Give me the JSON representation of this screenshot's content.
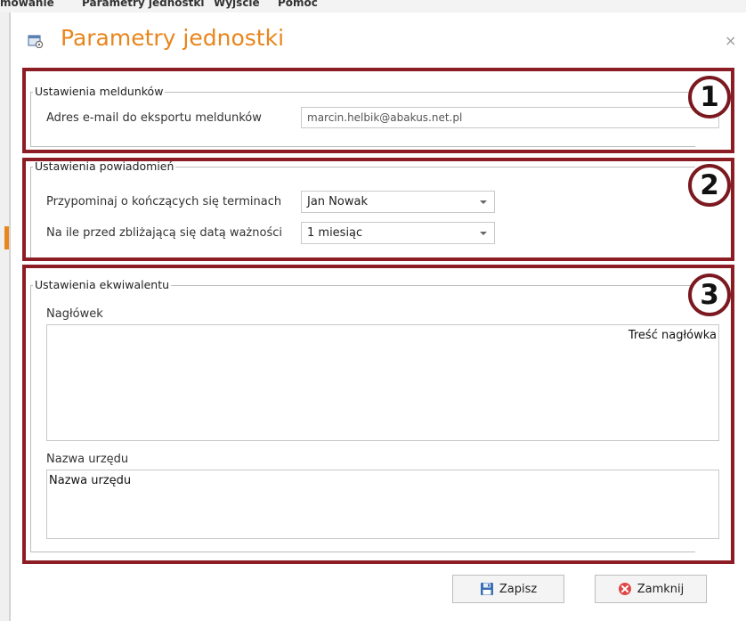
{
  "background_menu": {
    "items": [
      "mowanie",
      "Parametry jednostki",
      "Wyjście",
      "Pomoc"
    ]
  },
  "dialog": {
    "title": "Parametry jednostki",
    "title_color": "#e8861c",
    "close_glyph": "×"
  },
  "section_reports": {
    "badge": "1",
    "legend": "Ustawienia meldunków",
    "email_label": "Adres e-mail do eksportu meldunków",
    "email_value": "marcin.helbik@abakus.net.pl"
  },
  "section_notifications": {
    "badge": "2",
    "legend": "Ustawienia powiadomień",
    "remind_label": "Przypominaj o kończących się terminach",
    "remind_value": "Jan Nowak",
    "advance_label": "Na ile przed zbliżającą się datą ważności",
    "advance_value": "1 miesiąc"
  },
  "section_equivalent": {
    "badge": "3",
    "legend": "Ustawienia ekwiwalentu",
    "header_label": "Nagłówek",
    "header_value": "Treść nagłówka",
    "office_label": "Nazwa urzędu",
    "office_value": "Nazwa urzędu"
  },
  "buttons": {
    "save_label": "Zapisz",
    "close_label": "Zamknij"
  },
  "colors": {
    "annotation_frame": "#8c1d24",
    "accent": "#e8861c"
  },
  "icons": [
    "dialog-settings-icon",
    "close-icon",
    "dropdown-arrow-icon",
    "save-floppy-icon",
    "close-circle-icon"
  ]
}
